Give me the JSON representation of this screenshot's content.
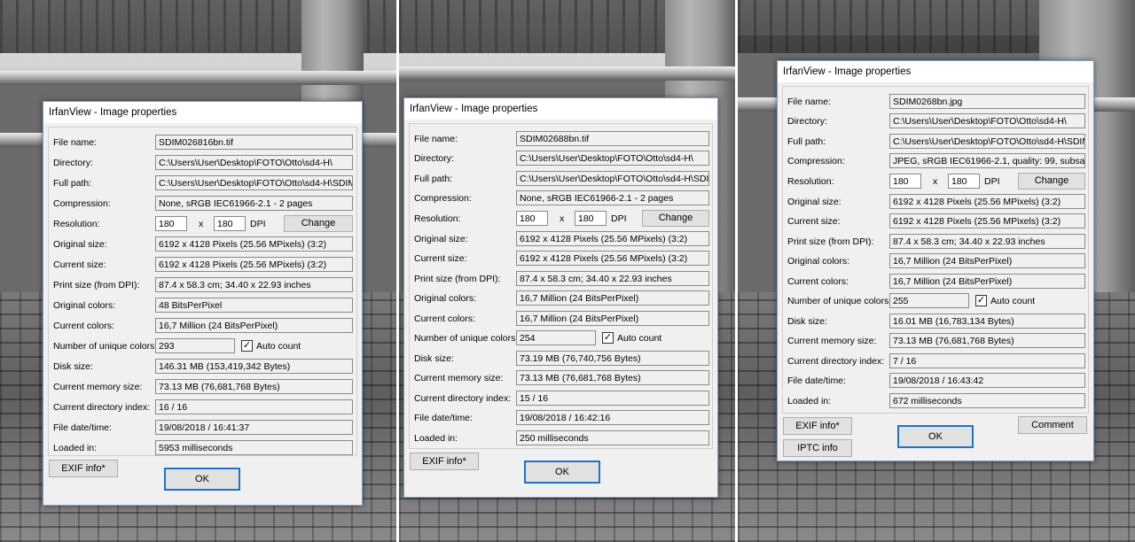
{
  "dialogs": [
    {
      "title": "IrfanView - Image properties",
      "labels": {
        "file_name": "File name:",
        "directory": "Directory:",
        "full_path": "Full path:",
        "compression": "Compression:",
        "resolution": "Resolution:",
        "original_size": "Original size:",
        "current_size": "Current size:",
        "print_size": "Print size (from DPI):",
        "original_colors": "Original colors:",
        "current_colors": "Current colors:",
        "unique_colors": "Number of unique colors:",
        "disk_size": "Disk size:",
        "memory_size": "Current memory size:",
        "dir_index": "Current directory index:",
        "file_date": "File date/time:",
        "loaded_in": "Loaded in:"
      },
      "values": {
        "file_name": "SDIM026816bn.tif",
        "directory": "C:\\Users\\User\\Desktop\\FOTO\\Otto\\sd4-H\\",
        "full_path": "C:\\Users\\User\\Desktop\\FOTO\\Otto\\sd4-H\\SDIM",
        "compression": "None, sRGB IEC61966-2.1 - 2 pages",
        "res_x": "180",
        "res_y": "180",
        "original_size": "6192 x 4128  Pixels (25.56 MPixels) (3:2)",
        "current_size": "6192 x 4128  Pixels (25.56 MPixels) (3:2)",
        "print_size": "87.4 x 58.3 cm; 34.40 x 22.93 inches",
        "original_colors": "48 BitsPerPixel",
        "current_colors": "16,7 Million   (24 BitsPerPixel)",
        "unique_colors": "293",
        "disk_size": "146.31 MB (153,419,342 Bytes)",
        "memory_size": "73.13  MB (76,681,768 Bytes)",
        "dir_index": "16  /  16",
        "file_date": "19/08/2018 / 16:41:37",
        "loaded_in": "5953 milliseconds"
      },
      "x_label": "x",
      "dpi_label": "DPI",
      "change_label": "Change",
      "auto_count_label": "Auto count",
      "auto_count_checked": "✓",
      "exif_label": "EXIF info*",
      "ok_label": "OK"
    },
    {
      "title": "IrfanView - Image properties",
      "labels": {
        "file_name": "File name:",
        "directory": "Directory:",
        "full_path": "Full path:",
        "compression": "Compression:",
        "resolution": "Resolution:",
        "original_size": "Original size:",
        "current_size": "Current size:",
        "print_size": "Print size (from DPI):",
        "original_colors": "Original colors:",
        "current_colors": "Current colors:",
        "unique_colors": "Number of unique colors:",
        "disk_size": "Disk size:",
        "memory_size": "Current memory size:",
        "dir_index": "Current directory index:",
        "file_date": "File date/time:",
        "loaded_in": "Loaded in:"
      },
      "values": {
        "file_name": "SDIM02688bn.tif",
        "directory": "C:\\Users\\User\\Desktop\\FOTO\\Otto\\sd4-H\\",
        "full_path": "C:\\Users\\User\\Desktop\\FOTO\\Otto\\sd4-H\\SDIM",
        "compression": "None, sRGB IEC61966-2.1 - 2 pages",
        "res_x": "180",
        "res_y": "180",
        "original_size": "6192 x 4128  Pixels (25.56 MPixels) (3:2)",
        "current_size": "6192 x 4128  Pixels (25.56 MPixels) (3:2)",
        "print_size": "87.4 x 58.3 cm; 34.40 x 22.93 inches",
        "original_colors": "16,7 Million   (24 BitsPerPixel)",
        "current_colors": "16,7 Million   (24 BitsPerPixel)",
        "unique_colors": "254",
        "disk_size": "73.19 MB (76,740,756 Bytes)",
        "memory_size": "73.13  MB (76,681,768 Bytes)",
        "dir_index": "15  /  16",
        "file_date": "19/08/2018 / 16:42:16",
        "loaded_in": "250 milliseconds"
      },
      "x_label": "x",
      "dpi_label": "DPI",
      "change_label": "Change",
      "auto_count_label": "Auto count",
      "auto_count_checked": "✓",
      "exif_label": "EXIF info*",
      "ok_label": "OK"
    },
    {
      "title": "IrfanView - Image properties",
      "labels": {
        "file_name": "File name:",
        "directory": "Directory:",
        "full_path": "Full path:",
        "compression": "Compression:",
        "resolution": "Resolution:",
        "original_size": "Original size:",
        "current_size": "Current size:",
        "print_size": "Print size (from DPI):",
        "original_colors": "Original colors:",
        "current_colors": "Current colors:",
        "unique_colors": "Number of unique colors:",
        "disk_size": "Disk size:",
        "memory_size": "Current memory size:",
        "dir_index": "Current directory index:",
        "file_date": "File date/time:",
        "loaded_in": "Loaded in:"
      },
      "values": {
        "file_name": "SDIM0268bn.jpg",
        "directory": "C:\\Users\\User\\Desktop\\FOTO\\Otto\\sd4-H\\",
        "full_path": "C:\\Users\\User\\Desktop\\FOTO\\Otto\\sd4-H\\SDIM",
        "compression": "JPEG, sRGB IEC61966-2.1, quality: 99, subsampli",
        "res_x": "180",
        "res_y": "180",
        "original_size": "6192 x 4128  Pixels (25.56 MPixels) (3:2)",
        "current_size": "6192 x 4128  Pixels (25.56 MPixels) (3:2)",
        "print_size": "87.4 x 58.3 cm; 34.40 x 22.93 inches",
        "original_colors": "16,7 Million   (24 BitsPerPixel)",
        "current_colors": "16,7 Million   (24 BitsPerPixel)",
        "unique_colors": "255",
        "disk_size": "16.01 MB (16,783,134 Bytes)",
        "memory_size": "73.13  MB (76,681,768 Bytes)",
        "dir_index": "7  /  16",
        "file_date": "19/08/2018 / 16:43:42",
        "loaded_in": "672 milliseconds"
      },
      "x_label": "x",
      "dpi_label": "DPI",
      "change_label": "Change",
      "auto_count_label": "Auto count",
      "auto_count_checked": "✓",
      "exif_label": "EXIF info*",
      "iptc_label": "IPTC info",
      "comment_label": "Comment",
      "ok_label": "OK"
    }
  ]
}
